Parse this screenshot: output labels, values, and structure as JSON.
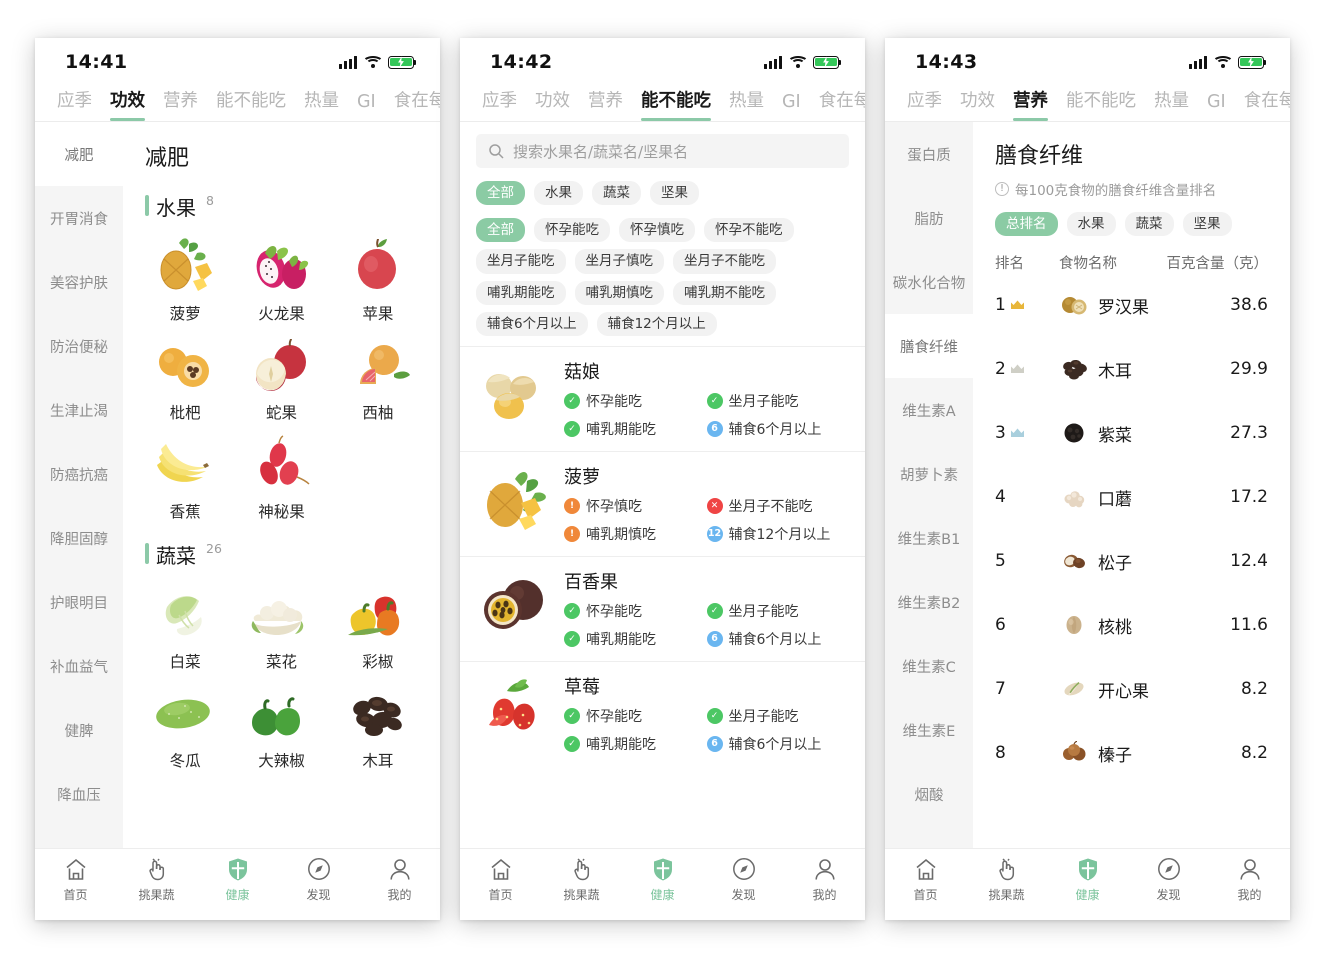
{
  "theme": {
    "accent": "#8cc9a8",
    "chip_on": "#8bcba4",
    "ok": "#4cc764",
    "warn": "#f0883a",
    "no": "#ef4444",
    "num": "#6ab6f0",
    "sidebar_bg": "#f5f5f5"
  },
  "panel1": {
    "status": {
      "time": "14:41"
    },
    "tabs": [
      {
        "label": "应季",
        "active": false
      },
      {
        "label": "功效",
        "active": true
      },
      {
        "label": "营养",
        "active": false
      },
      {
        "label": "能不能吃",
        "active": false
      },
      {
        "label": "热量",
        "active": false
      },
      {
        "label": "GI",
        "active": false
      },
      {
        "label": "食在每日",
        "active": false
      }
    ],
    "sidebar": [
      {
        "label": "减肥",
        "active": true
      },
      {
        "label": "开胃消食",
        "active": false
      },
      {
        "label": "美容护肤",
        "active": false
      },
      {
        "label": "防治便秘",
        "active": false
      },
      {
        "label": "生津止渴",
        "active": false
      },
      {
        "label": "防癌抗癌",
        "active": false
      },
      {
        "label": "降胆固醇",
        "active": false
      },
      {
        "label": "护眼明目",
        "active": false
      },
      {
        "label": "补血益气",
        "active": false
      },
      {
        "label": "健脾",
        "active": false
      },
      {
        "label": "降血压",
        "active": false
      }
    ],
    "page_title": "减肥",
    "sections": [
      {
        "name": "水果",
        "count": "8",
        "items": [
          {
            "label": "菠萝",
            "icon": "pineapple-icon"
          },
          {
            "label": "火龙果",
            "icon": "dragonfruit-icon"
          },
          {
            "label": "苹果",
            "icon": "apple-icon"
          },
          {
            "label": "枇杷",
            "icon": "loquat-icon"
          },
          {
            "label": "蛇果",
            "icon": "red-delicious-icon"
          },
          {
            "label": "西柚",
            "icon": "grapefruit-icon"
          },
          {
            "label": "香蕉",
            "icon": "banana-icon"
          },
          {
            "label": "神秘果",
            "icon": "miracle-fruit-icon"
          }
        ]
      },
      {
        "name": "蔬菜",
        "count": "26",
        "items": [
          {
            "label": "白菜",
            "icon": "napa-cabbage-icon"
          },
          {
            "label": "菜花",
            "icon": "cauliflower-icon"
          },
          {
            "label": "彩椒",
            "icon": "bell-pepper-icon"
          },
          {
            "label": "冬瓜",
            "icon": "winter-melon-icon"
          },
          {
            "label": "大辣椒",
            "icon": "green-pepper-icon"
          },
          {
            "label": "木耳",
            "icon": "wood-ear-icon"
          }
        ]
      }
    ]
  },
  "panel2": {
    "status": {
      "time": "14:42"
    },
    "tabs": [
      {
        "label": "应季",
        "active": false
      },
      {
        "label": "功效",
        "active": false
      },
      {
        "label": "营养",
        "active": false
      },
      {
        "label": "能不能吃",
        "active": true
      },
      {
        "label": "热量",
        "active": false
      },
      {
        "label": "GI",
        "active": false
      },
      {
        "label": "食在每日",
        "active": false
      }
    ],
    "search": {
      "placeholder": "搜索水果名/蔬菜名/坚果名",
      "value": ""
    },
    "category_chips": [
      {
        "label": "全部",
        "active": true
      },
      {
        "label": "水果",
        "active": false
      },
      {
        "label": "蔬菜",
        "active": false
      },
      {
        "label": "坚果",
        "active": false
      }
    ],
    "condition_chips": [
      {
        "label": "全部",
        "active": true
      },
      {
        "label": "怀孕能吃",
        "active": false
      },
      {
        "label": "怀孕慎吃",
        "active": false
      },
      {
        "label": "怀孕不能吃",
        "active": false
      },
      {
        "label": "坐月子能吃",
        "active": false
      },
      {
        "label": "坐月子慎吃",
        "active": false
      },
      {
        "label": "坐月子不能吃",
        "active": false
      },
      {
        "label": "哺乳期能吃",
        "active": false
      },
      {
        "label": "哺乳期慎吃",
        "active": false
      },
      {
        "label": "哺乳期不能吃",
        "active": false
      },
      {
        "label": "辅食6个月以上",
        "active": false
      },
      {
        "label": "辅食12个月以上",
        "active": false
      }
    ],
    "foods": [
      {
        "name": "菇娘",
        "icon": "goldenberry-icon",
        "tags": [
          {
            "label": "怀孕能吃",
            "state": "ok",
            "glyph": "✓"
          },
          {
            "label": "坐月子能吃",
            "state": "ok",
            "glyph": "✓"
          },
          {
            "label": "哺乳期能吃",
            "state": "ok",
            "glyph": "✓"
          },
          {
            "label": "辅食6个月以上",
            "state": "num",
            "glyph": "6"
          }
        ]
      },
      {
        "name": "菠萝",
        "icon": "pineapple-icon",
        "tags": [
          {
            "label": "怀孕慎吃",
            "state": "warn",
            "glyph": "!"
          },
          {
            "label": "坐月子不能吃",
            "state": "no",
            "glyph": "✕"
          },
          {
            "label": "哺乳期慎吃",
            "state": "warn",
            "glyph": "!"
          },
          {
            "label": "辅食12个月以上",
            "state": "num",
            "glyph": "12"
          }
        ]
      },
      {
        "name": "百香果",
        "icon": "passionfruit-icon",
        "tags": [
          {
            "label": "怀孕能吃",
            "state": "ok",
            "glyph": "✓"
          },
          {
            "label": "坐月子能吃",
            "state": "ok",
            "glyph": "✓"
          },
          {
            "label": "哺乳期能吃",
            "state": "ok",
            "glyph": "✓"
          },
          {
            "label": "辅食6个月以上",
            "state": "num",
            "glyph": "6"
          }
        ]
      },
      {
        "name": "草莓",
        "icon": "strawberry-icon",
        "tags": [
          {
            "label": "怀孕能吃",
            "state": "ok",
            "glyph": "✓"
          },
          {
            "label": "坐月子能吃",
            "state": "ok",
            "glyph": "✓"
          },
          {
            "label": "哺乳期能吃",
            "state": "ok",
            "glyph": "✓"
          },
          {
            "label": "辅食6个月以上",
            "state": "num",
            "glyph": "6"
          }
        ]
      }
    ]
  },
  "panel3": {
    "status": {
      "time": "14:43"
    },
    "tabs": [
      {
        "label": "应季",
        "active": false
      },
      {
        "label": "功效",
        "active": false
      },
      {
        "label": "营养",
        "active": true
      },
      {
        "label": "能不能吃",
        "active": false
      },
      {
        "label": "热量",
        "active": false
      },
      {
        "label": "GI",
        "active": false
      },
      {
        "label": "食在每日",
        "active": false
      }
    ],
    "sidebar": [
      {
        "label": "蛋白质",
        "active": false
      },
      {
        "label": "脂肪",
        "active": false
      },
      {
        "label": "碳水化合物",
        "active": false
      },
      {
        "label": "膳食纤维",
        "active": true
      },
      {
        "label": "维生素A",
        "active": false
      },
      {
        "label": "胡萝卜素",
        "active": false
      },
      {
        "label": "维生素B1",
        "active": false
      },
      {
        "label": "维生素B2",
        "active": false
      },
      {
        "label": "维生素C",
        "active": false
      },
      {
        "label": "维生素E",
        "active": false
      },
      {
        "label": "烟酸",
        "active": false
      }
    ],
    "title": "膳食纤维",
    "subtitle": "每100克食物的膳食纤维含量排名",
    "chips": [
      {
        "label": "总排名",
        "active": true
      },
      {
        "label": "水果",
        "active": false
      },
      {
        "label": "蔬菜",
        "active": false
      },
      {
        "label": "坚果",
        "active": false
      }
    ],
    "table": {
      "headers": [
        "排名",
        "食物名称",
        "百克含量（克）"
      ],
      "rows": [
        {
          "rank": "1",
          "medal": "gold",
          "name": "罗汉果",
          "icon": "monk-fruit-icon",
          "value": "38.6"
        },
        {
          "rank": "2",
          "medal": "silver",
          "name": "木耳",
          "icon": "wood-ear-icon",
          "value": "29.9"
        },
        {
          "rank": "3",
          "medal": "bronze",
          "name": "紫菜",
          "icon": "seaweed-icon",
          "value": "27.3"
        },
        {
          "rank": "4",
          "medal": "",
          "name": "口蘑",
          "icon": "button-mushroom-icon",
          "value": "17.2"
        },
        {
          "rank": "5",
          "medal": "",
          "name": "松子",
          "icon": "pine-nut-icon",
          "value": "12.4"
        },
        {
          "rank": "6",
          "medal": "",
          "name": "核桃",
          "icon": "walnut-icon",
          "value": "11.6"
        },
        {
          "rank": "7",
          "medal": "",
          "name": "开心果",
          "icon": "pistachio-icon",
          "value": "8.2"
        },
        {
          "rank": "8",
          "medal": "",
          "name": "榛子",
          "icon": "hazelnut-icon",
          "value": "8.2"
        }
      ]
    }
  },
  "bottom_nav": [
    {
      "label": "首页",
      "icon": "home-icon",
      "active": false
    },
    {
      "label": "挑果蔬",
      "icon": "hand-pick-icon",
      "active": false
    },
    {
      "label": "健康",
      "icon": "shield-health-icon",
      "active": true
    },
    {
      "label": "发现",
      "icon": "compass-icon",
      "active": false
    },
    {
      "label": "我的",
      "icon": "person-icon",
      "active": false
    }
  ]
}
